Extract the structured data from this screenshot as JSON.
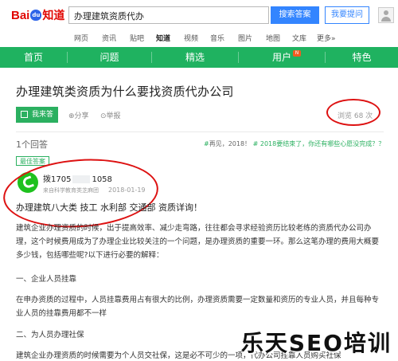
{
  "header": {
    "logo": {
      "bai": "Bai",
      "du": "du",
      "zhi": "知道"
    },
    "search_value": "办理建筑资质代办",
    "search_button": "搜索答案",
    "ask_button": "我要提问"
  },
  "channels": [
    "网页",
    "资讯",
    "贴吧",
    "知道",
    "视频",
    "音乐",
    "图片",
    "地图",
    "文库",
    "更多»"
  ],
  "active_channel": "知道",
  "nav": {
    "items": [
      "首页",
      "问题",
      "精选",
      "用户",
      "特色"
    ],
    "badge": "N"
  },
  "question": {
    "title": "办理建筑类资质为什么要找资质代办公司",
    "answer_button": "我来答",
    "share": "分享",
    "report": "举报",
    "views": "浏览 68 次"
  },
  "answers": {
    "count": "1个回答",
    "related_hash": "#",
    "related_text": "再见，2018！",
    "related_link": "# 2018要结束了，你还有哪些心愿没完成？？",
    "best_tag": "最佳答案",
    "answerer_name": "拨1705",
    "answerer_name_tail": "1058",
    "answerer_org": "来自科学教育类芝麻团",
    "date": "2018-01-19",
    "head_line": "办理建筑八大类 技工 水利部 交通部 资质详询！",
    "paragraphs": [
      "建筑企业办理资质的时候，出于提高效率、减少走弯路，往往都会寻求经验资历比较老练的资质代办公司办理，这个时候费用成为了办理企业比较关注的一个问题，是办理资质的重要一环。那么这笔办理的费用大概要多少钱，包括哪些呢?以下进行必要的解释：",
      "一、企业人员挂靠",
      "在申办资质的过程中，人员挂靠费用占有很大的比例，办理资质需要一定数量和资历的专业人员，并且每种专业人员的挂靠费用都不一样",
      "二、为人员办理社保",
      "建筑企业办理资质的时候需要为个人员交社保，这是必不可少的一项，代办公司挂靠人员购买社保"
    ]
  },
  "watermark": "乐天SEO培训",
  "colors": {
    "green": "#1fb260",
    "blue": "#3385ff",
    "red_circle": "#dd1111"
  }
}
